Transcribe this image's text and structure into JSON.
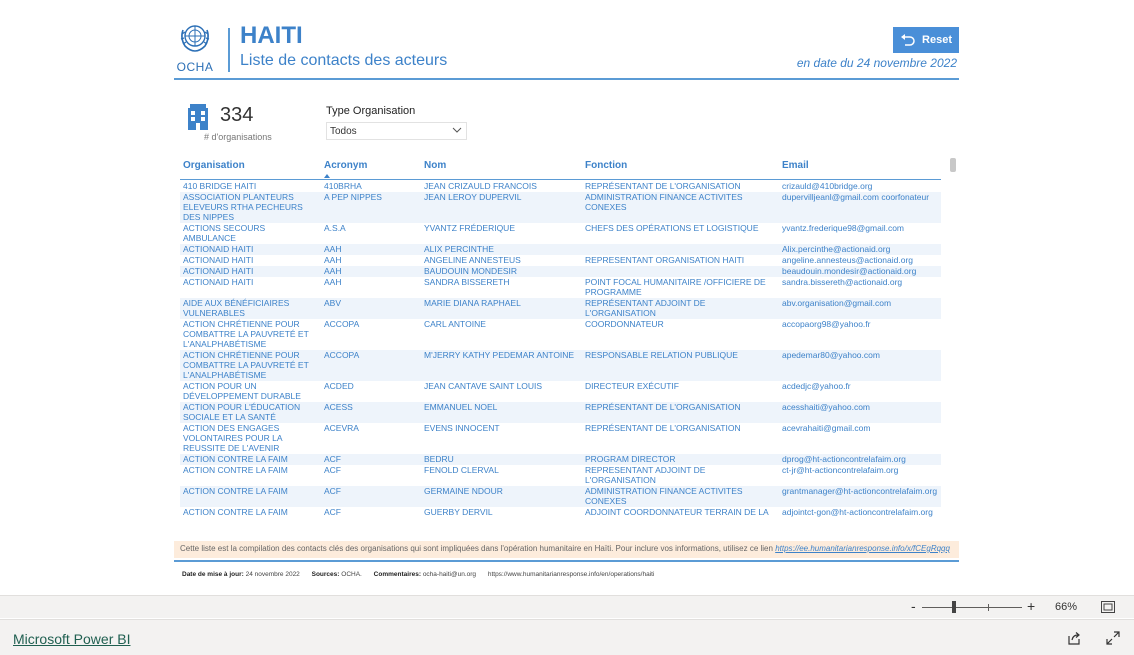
{
  "header": {
    "logo_text": "OCHA",
    "title": "HAITI",
    "subtitle": "Liste de contacts des acteurs",
    "reset_label": "Reset",
    "date_note": "en date du 24 novembre 2022"
  },
  "kpi": {
    "value": "334",
    "label": "# d'organisations"
  },
  "filter": {
    "label": "Type Organisation",
    "value": "Todos"
  },
  "table": {
    "columns": [
      "Organisation",
      "Acronym",
      "Nom",
      "Fonction",
      "Email"
    ],
    "sorted_column": "Acronym",
    "rows": [
      [
        "410 BRIDGE HAITI",
        "410BRHA",
        "JEAN CRIZAULD FRANCOIS",
        "REPRÉSENTANT DE L'ORGANISATION",
        "crizauld@410bridge.org"
      ],
      [
        "ASSOCIATION PLANTEURS ELEVEURS RTHA PECHEURS DES NIPPES",
        "A PEP NIPPES",
        "JEAN LEROY DUPERVIL",
        "ADMINISTRATION FINANCE ACTIVITES CONEXES",
        "dupervilljeanl@gmail.com coorfonateur"
      ],
      [
        "ACTIONS SECOURS AMBULANCE",
        "A.S.A",
        "YVANTZ FRÉDERIQUE",
        "CHEFS DES OPÉRATIONS ET LOGISTIQUE",
        "yvantz.frederique98@gmail.com"
      ],
      [
        "ACTIONAID HAITI",
        "AAH",
        "ALIX PERCINTHE",
        "",
        "Alix.percinthe@actionaid.org"
      ],
      [
        "ACTIONAID HAITI",
        "AAH",
        "ANGELINE ANNESTEUS",
        "REPRESENTANT ORGANISATION HAITI",
        "angeline.annesteus@actionaid.org"
      ],
      [
        "ACTIONAID HAITI",
        "AAH",
        "BAUDOUIN MONDESIR",
        "",
        "beaudouin.mondesir@actionaid.org"
      ],
      [
        "ACTIONAID HAITI",
        "AAH",
        "SANDRA BISSERETH",
        "POINT FOCAL HUMANITAIRE /OFFICIERE DE PROGRAMME",
        "sandra.bissereth@actionaid.org"
      ],
      [
        "AIDE AUX BÉNÉFICIAIRES VULNERABLES",
        "ABV",
        "MARIE DIANA RAPHAEL",
        "REPRÉSENTANT ADJOINT DE L'ORGANISATION",
        "abv.organisation@gmail.com"
      ],
      [
        "ACTION CHRÉTIENNE POUR COMBATTRE LA PAUVRETÉ ET L'ANALPHABÉTISME",
        "ACCOPA",
        "CARL ANTOINE",
        "COORDONNATEUR",
        "accopaorg98@yahoo.fr"
      ],
      [
        "ACTION CHRÉTIENNE POUR COMBATTRE LA PAUVRETÉ ET L'ANALPHABÉTISME",
        "ACCOPA",
        "M'JERRY KATHY PEDEMAR ANTOINE",
        "RESPONSABLE RELATION PUBLIQUE",
        "apedemar80@yahoo.com"
      ],
      [
        "ACTION POUR UN DÉVELOPPEMENT DURABLE",
        "ACDED",
        "JEAN CANTAVE SAINT LOUIS",
        "DIRECTEUR EXÉCUTIF",
        "acdedjc@yahoo.fr"
      ],
      [
        "ACTION POUR L'ÉDUCATION SOCIALE ET LA SANTÉ",
        "ACESS",
        "EMMANUEL NOEL",
        "REPRÉSENTANT DE L'ORGANISATION",
        "acesshaiti@yahoo.com"
      ],
      [
        "ACTION DES ENGAGES VOLONTAIRES POUR LA REUSSITE DE L'AVENIR",
        "ACEVRA",
        "EVENS INNOCENT",
        "REPRÉSENTANT DE L'ORGANISATION",
        "acevrahaiti@gmail.com"
      ],
      [
        "ACTION CONTRE LA FAIM",
        "ACF",
        "BEDRU",
        "PROGRAM DIRECTOR",
        "dprog@ht-actioncontrelafaim.org"
      ],
      [
        "ACTION CONTRE LA FAIM",
        "ACF",
        "FENOLD CLERVAL",
        "REPRESENTANT ADJOINT DE L'ORGANISATION",
        "ct-jr@ht-actioncontrelafaim.org"
      ],
      [
        "ACTION CONTRE LA FAIM",
        "ACF",
        "GERMAINE NDOUR",
        "ADMINISTRATION FINANCE ACTIVITES CONEXES",
        "grantmanager@ht-actioncontrelafaim.org"
      ],
      [
        "ACTION CONTRE LA FAIM",
        "ACF",
        "GUERBY DERVIL",
        "ADJOINT COORDONNATEUR TERRAIN DE LA",
        "adjointct-gon@ht-actioncontrelafaim.org"
      ]
    ]
  },
  "note": {
    "text": "Cette liste est la compilation des contacts clés des organisations qui sont impliquées dans l'opération humanitaire en Haïti. Pour inclure vos informations, utilisez ce lien",
    "link": "https://ee.humanitarianresponse.info/x/fCEgRqqq"
  },
  "footer": {
    "update_label": "Date de mise à jour:",
    "update_value": "24 novembre 2022",
    "sources_label": "Sources:",
    "sources_value": "OCHA.",
    "comments_label": "Commentaires:",
    "comments_value": "ocha-haiti@un.org",
    "url": "https://www.humanitarianresponse.info/en/operations/haiti"
  },
  "zoom": {
    "minus": "-",
    "plus": "+",
    "percent": "66%"
  },
  "bottom": {
    "brand_link": "Microsoft Power BI"
  },
  "colors": {
    "accent": "#3d82c9",
    "button": "#4a8fd8",
    "row_alt": "#eef4fb",
    "note_bg": "#fdecdc",
    "brand_link": "#1f5f50"
  },
  "icons": [
    "un-emblem-icon",
    "reset-icon",
    "building-icon",
    "chevron-down-icon",
    "sort-ascending-icon",
    "fit-to-page-icon",
    "share-icon",
    "expand-icon"
  ]
}
